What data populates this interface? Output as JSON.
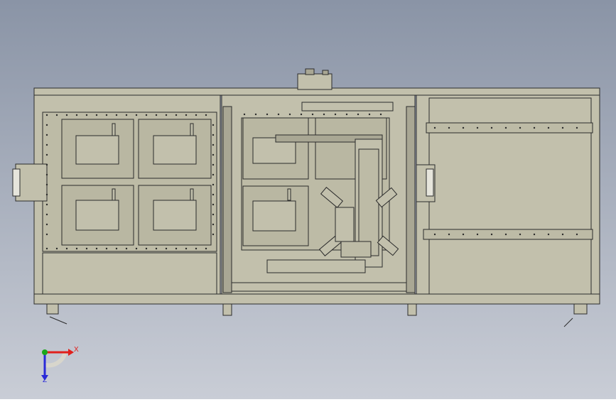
{
  "colors": {
    "background_top": "#8a94a6",
    "background_bottom": "#c9cdd6",
    "frame_fill": "#c2c0ac",
    "frame_dark": "#a9a794",
    "panel_fill": "#bdbba6",
    "line": "#2b2b2b",
    "axis_x": "#e0201c",
    "axis_y": "#2a2ad8",
    "axis_origin": "#1aa81a"
  },
  "triad": {
    "x_label": "X",
    "z_label": "Z"
  }
}
